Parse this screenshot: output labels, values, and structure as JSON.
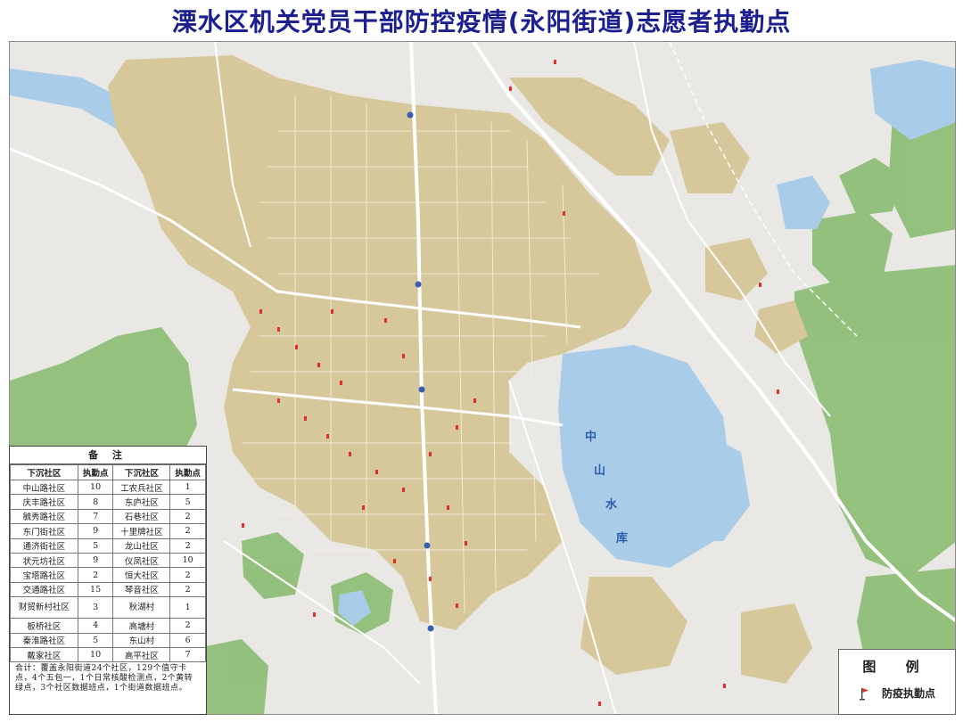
{
  "title": "溧水区机关党员干部防控疫情(永阳街道)志愿者执勤点",
  "lake_labels": [
    "中",
    "山",
    "水",
    "库"
  ],
  "notes": {
    "heading": "备 注",
    "headers": [
      "下沉社区",
      "执勤点",
      "下沉社区",
      "执勤点"
    ],
    "rows": [
      [
        "中山路社区",
        "10",
        "工农兵社区",
        "1"
      ],
      [
        "庆丰路社区",
        "8",
        "东庐社区",
        "5"
      ],
      [
        "毓秀路社区",
        "7",
        "石巷社区",
        "2"
      ],
      [
        "东门街社区",
        "9",
        "十里牌社区",
        "2"
      ],
      [
        "通济街社区",
        "5",
        "龙山社区",
        "2"
      ],
      [
        "状元坊社区",
        "9",
        "仪凤社区",
        "10"
      ],
      [
        "宝塔路社区",
        "2",
        "恒大社区",
        "2"
      ],
      [
        "交通路社区",
        "15",
        "琴音社区",
        "2"
      ],
      [
        "财贸新村社区",
        "3",
        "秋湖村",
        "1"
      ],
      [
        "板桥社区",
        "4",
        "高塘村",
        "2"
      ],
      [
        "秦淮路社区",
        "5",
        "东山村",
        "6"
      ],
      [
        "戴家社区",
        "10",
        "高平社区",
        "7"
      ]
    ],
    "summary": "合计：覆盖永阳街道24个社区，129个值守卡点，4个五包一，1个日常核酸检测点，2个黄转绿点，3个社区数据班点，1个街道数据班点。"
  },
  "legend": {
    "title": "图 例",
    "item_label": "防疫执勤点",
    "item_icon": "red-flag-icon"
  },
  "colors": {
    "urban": "#d6c89a",
    "water": "#a9cde8",
    "green": "#9cc97f",
    "forest": "#7fb36e",
    "background": "#e9e8e4",
    "road": "#ffffff",
    "marker": "#e0302a",
    "title": "#1b1f8f"
  }
}
